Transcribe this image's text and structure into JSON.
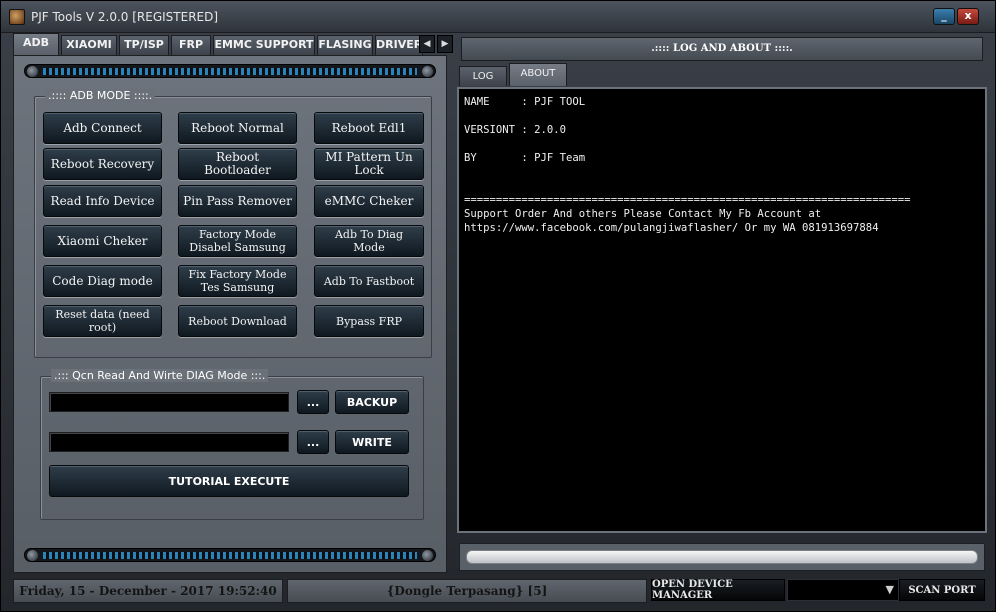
{
  "window": {
    "title": "PJF Tools V 2.0.0  [REGISTERED]",
    "minimize": "_",
    "close": "x"
  },
  "tabs": [
    "ADB",
    "XIAOMI",
    "TP/ISP",
    "FRP",
    "EMMC SUPPORT",
    "FLASING",
    "DRIVER"
  ],
  "adb_mode": {
    "title": ".:::: ADB MODE ::::.",
    "buttons": [
      "Adb Connect",
      "Reboot Normal",
      "Reboot Edl1",
      "Reboot Recovery",
      "Reboot Bootloader",
      "MI Pattern Un Lock",
      "Read Info Device",
      "Pin Pass Remover",
      "eMMC Cheker",
      "Xiaomi Cheker",
      "Factory Mode Disabel Samsung",
      "Adb To Diag Mode",
      "Code Diag mode",
      "Fix Factory Mode Tes Samsung",
      "Adb To Fastboot",
      "Reset data (need root)",
      "Reboot Download",
      "Bypass FRP"
    ]
  },
  "qcn": {
    "title": ".::: Qcn Read And Wirte DIAG Mode :::.",
    "backup_path": "",
    "write_path": "",
    "browse": "...",
    "backup": "BACKUP",
    "write": "WRITE",
    "tutorial": "TUTORIAL EXECUTE"
  },
  "right": {
    "header": ".:::: LOG AND ABOUT ::::.",
    "tabs": [
      "LOG",
      "ABOUT"
    ],
    "active_tab": "ABOUT",
    "console_lines": [
      "NAME     : PJF TOOL",
      "",
      "VERSIONT : 2.0.0",
      "",
      "BY       : PJF Team",
      "",
      "",
      "======================================================================",
      "Support Order And others Please Contact My Fb Account at",
      "https://www.facebook.com/pulangjiwaflasher/ Or my WA 081913697884"
    ]
  },
  "status": {
    "datetime": "Friday, 15 - December - 2017  19:52:40",
    "dongle": "{Dongle Terpasang}  [5]",
    "open_device_manager": "OPEN DEVICE MANAGER",
    "port_value": "",
    "scan_port": "SCAN PORT"
  }
}
